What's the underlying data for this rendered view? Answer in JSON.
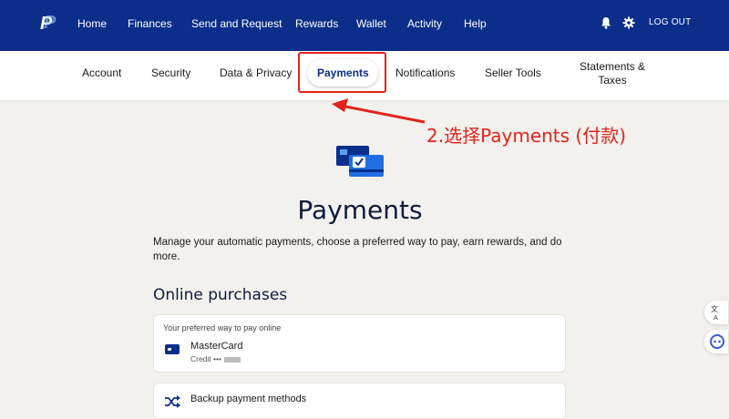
{
  "top_nav": {
    "logo": "P",
    "items": [
      "Home",
      "Finances",
      "Send and Request",
      "Rewards",
      "Wallet",
      "Activity",
      "Help"
    ],
    "logout": "LOG OUT"
  },
  "sub_nav": {
    "items": [
      "Account",
      "Security",
      "Data & Privacy",
      "Payments",
      "Notifications",
      "Seller Tools"
    ],
    "statements_line1": "Statements &",
    "statements_line2": "Taxes",
    "active": "Payments"
  },
  "annotation": {
    "text": "2.选择Payments (付款)",
    "color": "#e2231a"
  },
  "main": {
    "title": "Payments",
    "description": "Manage your automatic payments, choose a preferred way to pay, earn rewards, and do more.",
    "section_title": "Online purchases",
    "preferred_card": {
      "label": "Your preferred way to pay online",
      "name": "MasterCard",
      "sub": "Credit •••"
    },
    "backup": {
      "label": "Backup payment methods"
    }
  },
  "colors": {
    "brand_navy": "#0b2e8a",
    "background": "#f3f1ee",
    "annotation_red": "#e2231a"
  },
  "icons": {
    "bell": "bell-icon",
    "settings": "gear-icon",
    "payments": "payment-cards-icon",
    "credit_card": "credit-card-icon",
    "backup": "shuffle-icon",
    "translate": "translate-icon",
    "assistant": "assistant-icon"
  }
}
